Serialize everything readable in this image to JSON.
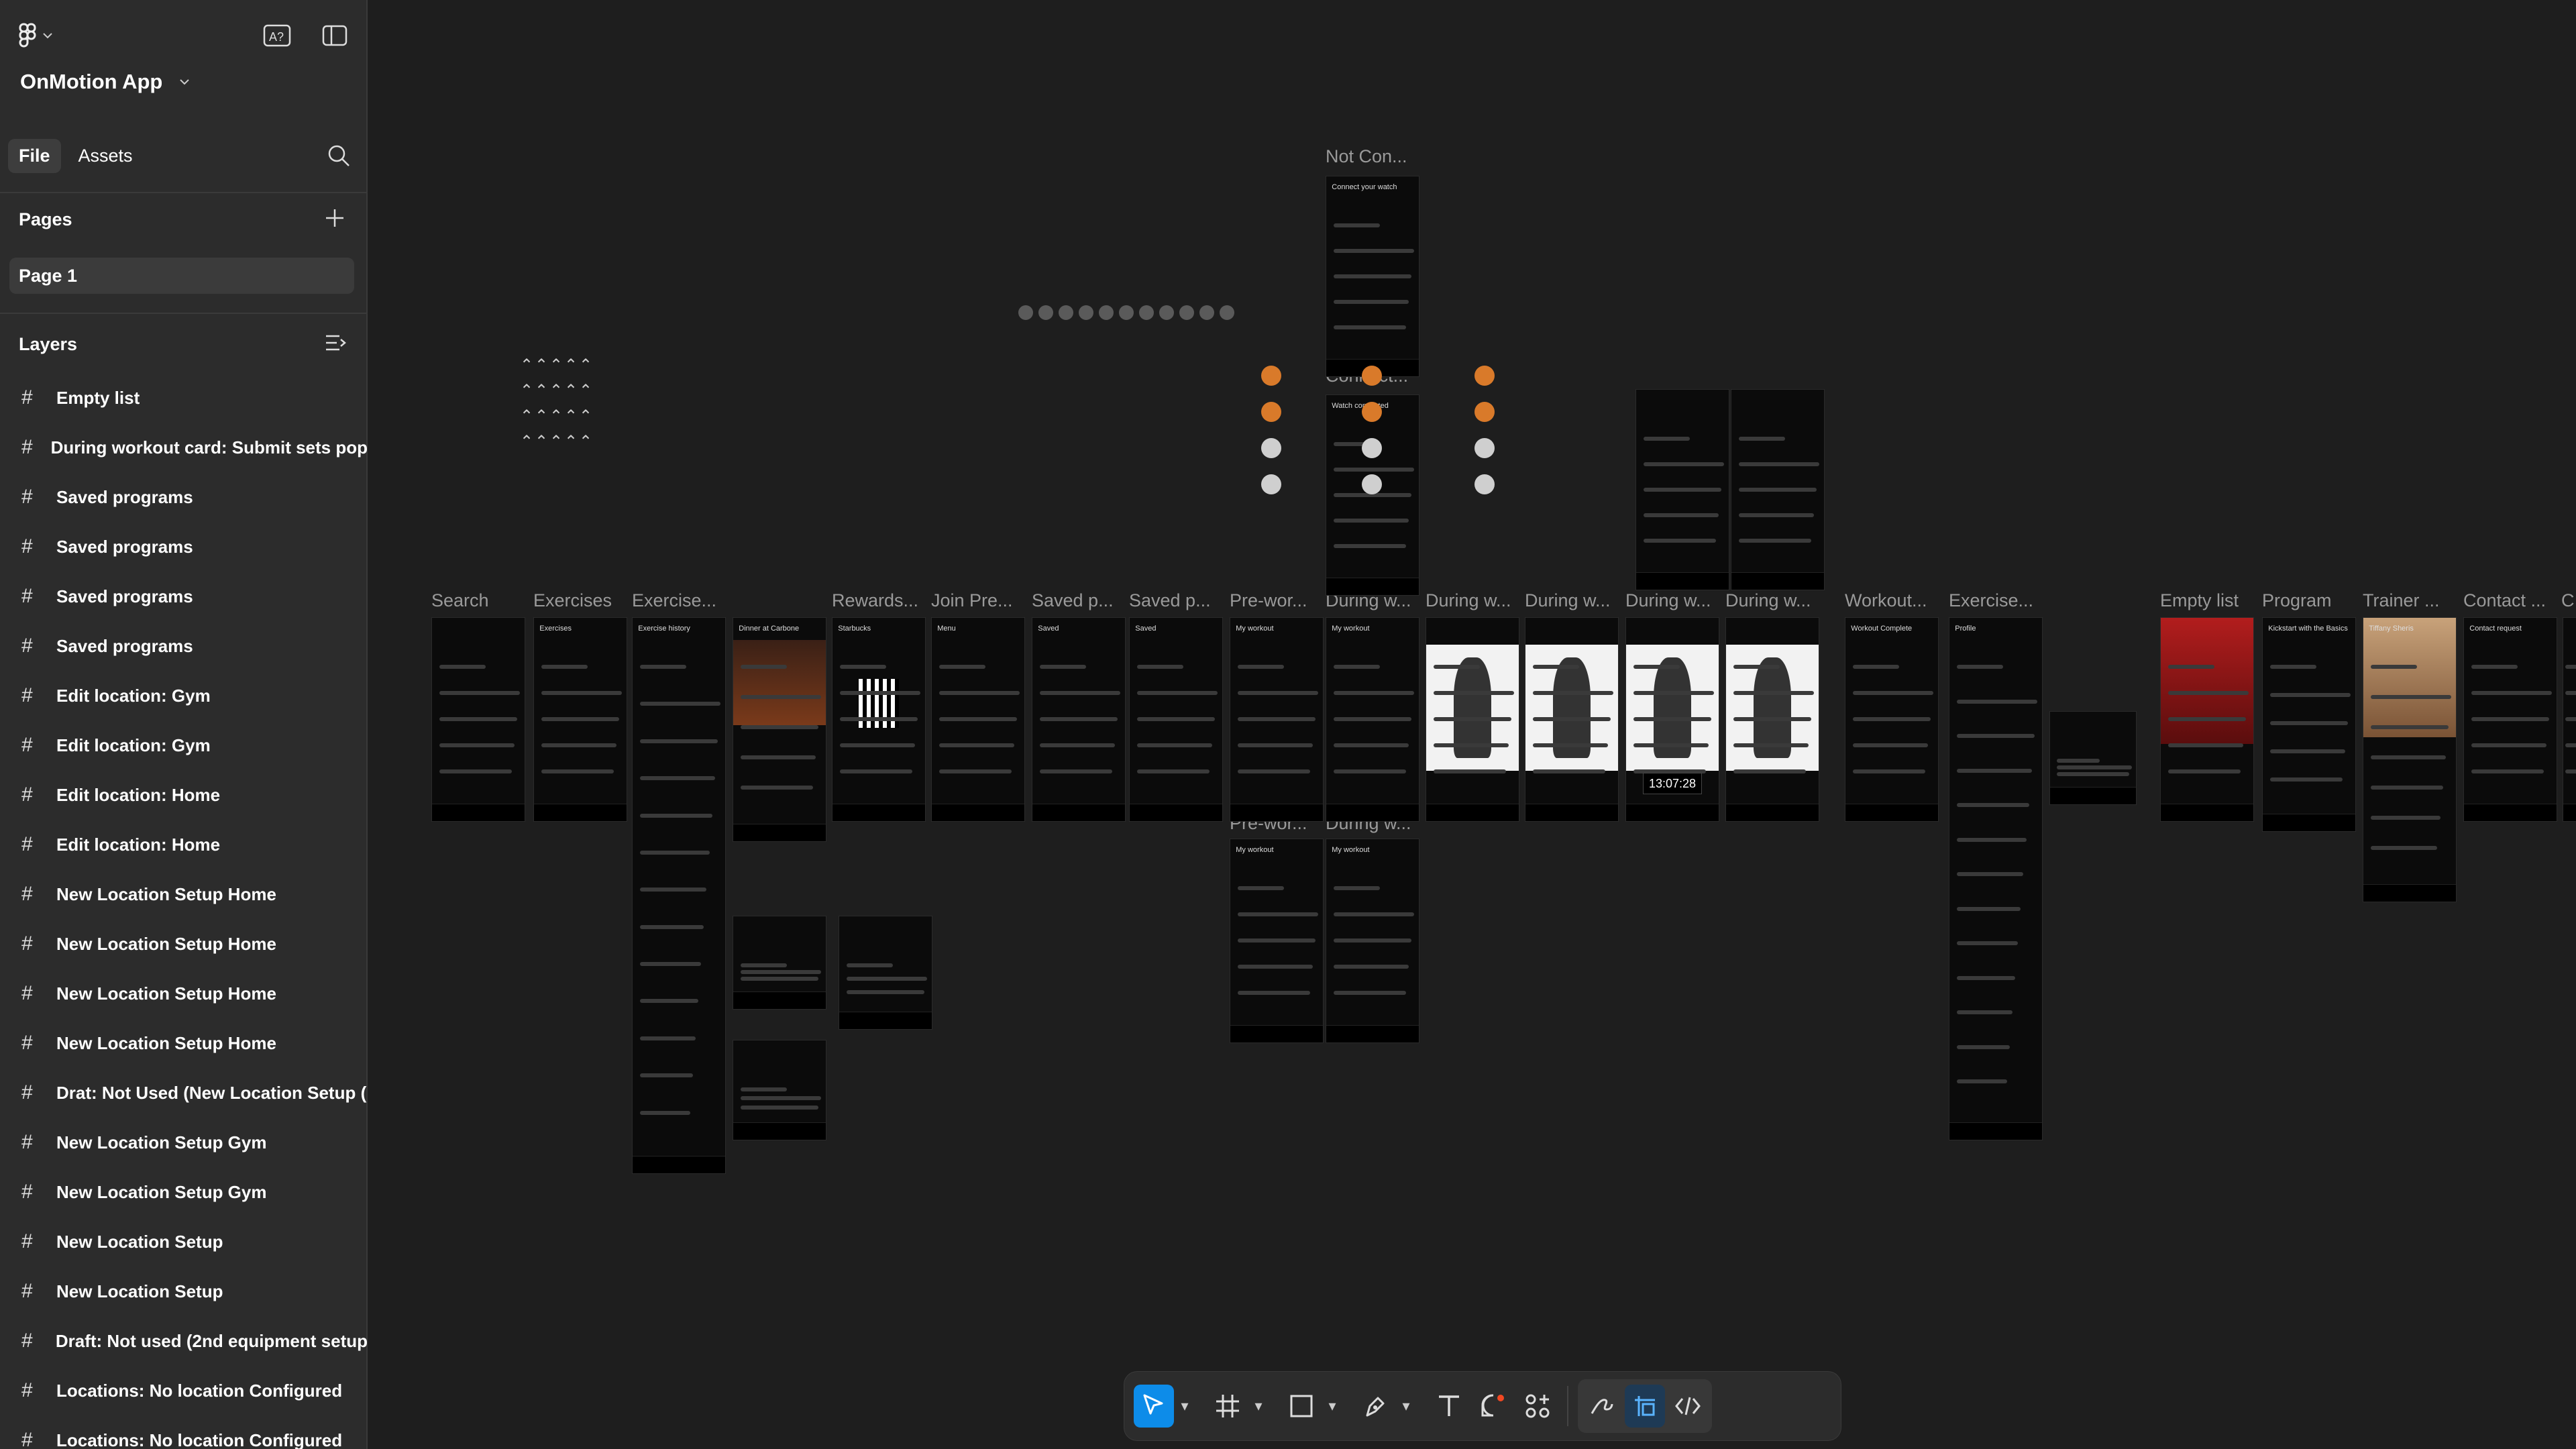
{
  "app": {
    "project_name": "OnMotion App"
  },
  "panel": {
    "tabs": [
      {
        "label": "File",
        "active": true
      },
      {
        "label": "Assets",
        "active": false
      }
    ],
    "pages_heading": "Pages",
    "pages": [
      "Page 1"
    ],
    "layers_heading": "Layers",
    "layers": [
      "Empty list",
      "During workout card: Submit sets pop",
      "Saved programs",
      "Saved programs",
      "Saved programs",
      "Saved programs",
      "Edit location: Gym",
      "Edit location: Gym",
      "Edit location: Home",
      "Edit location: Home",
      "New Location Setup Home",
      "New Location Setup Home",
      "New Location Setup Home",
      "New Location Setup Home",
      "Drat: Not Used (New Location Setup (",
      "New Location Setup Gym",
      "New Location Setup Gym",
      "New Location Setup",
      "New Location Setup",
      "Draft: Not used (2nd equipment setup",
      "Locations: No location Configured",
      "Locations: No location Configured"
    ]
  },
  "canvas": {
    "frame_labels": [
      "Search",
      "Exercises",
      "Exercise...",
      "Rewards...",
      "Join Pre...",
      "Saved p...",
      "Saved p...",
      "Pre-wor...",
      "During w...",
      "During w...",
      "During w...",
      "During w...",
      "During w...",
      "Workout...",
      "Exercise...",
      "Empty list",
      "Program",
      "Trainer ...",
      "Contact ...",
      "C"
    ],
    "top_labels": [
      "Not Con...",
      "Connect..."
    ],
    "lower_labels": [
      "Pre-wor...",
      "During w..."
    ],
    "screen_titles": {
      "exercises": "Exercises",
      "exercise_history": "Exercise history",
      "rewards": "Rewards",
      "starbucks": "Starbucks",
      "menu": "Menu",
      "saved": "Saved",
      "my_workout": "My workout",
      "workout_complete": "Workout Complete",
      "profile": "Profile",
      "program": "Kickstart with the Basics",
      "trainer": "Tiffany Sheris",
      "contact": "Contact request",
      "connect_watch": "Connect your watch",
      "watch_connected": "Watch connected",
      "dinner": "Dinner at Carbone",
      "timer": "13:07:28"
    }
  },
  "toolbar": {
    "tools": [
      "move-tool",
      "frame-tool",
      "shape-tool",
      "pen-tool",
      "text-tool",
      "comment-tool",
      "actions-tool"
    ],
    "active": "move-tool",
    "right_tools": [
      "draw-mode",
      "design-mode",
      "dev-mode"
    ]
  },
  "colors": {
    "accent": "#0d8ce9",
    "panel": "#2c2c2c",
    "canvas": "#1e1e1e",
    "medal_orange": "#d97a2a"
  }
}
